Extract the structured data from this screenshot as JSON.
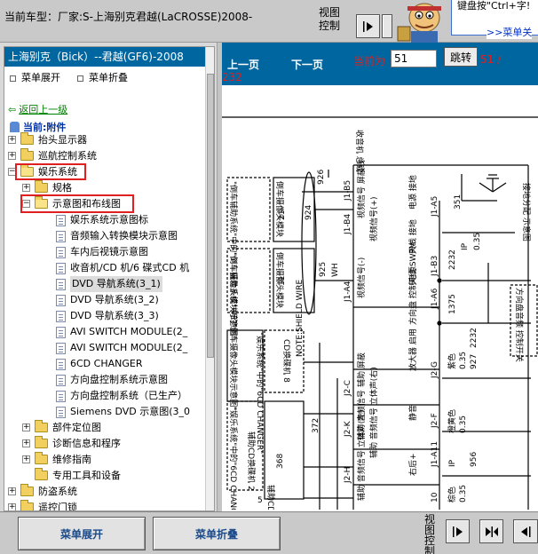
{
  "top": {
    "car_label": "当前车型：厂家:S-上海别克君越(LaCROSSE)2008-",
    "view_control": "视图控制",
    "tip_text": "键盘按\"Ctrl+字!",
    "tip_link": ">>菜单关"
  },
  "left": {
    "model_header": "上海别克（Bick）--君越(GF6)-2008",
    "menu_expand": "菜单展开",
    "menu_collapse": "菜单折叠",
    "back_link": "返回上一级",
    "current": "当前:附件",
    "tree": [
      {
        "label": "抬头显示器"
      },
      {
        "label": "巡航控制系统"
      },
      {
        "label": "娱乐系统"
      },
      {
        "label": "规格"
      },
      {
        "label": "示意图和布线图"
      },
      {
        "label": "娱乐系统示意图标"
      },
      {
        "label": "音频输入转换模块示意图"
      },
      {
        "label": "车内后视镜示意图"
      },
      {
        "label": "收音机/CD 机/6 碟式CD 机"
      },
      {
        "label": "DVD 导航系统(3_1)"
      },
      {
        "label": "DVD 导航系统(3_2)"
      },
      {
        "label": "DVD 导航系统(3_3)"
      },
      {
        "label": "AVI SWITCH MODULE(2_"
      },
      {
        "label": "AVI SWITCH MODULE(2_"
      },
      {
        "label": "6CD CHANGER"
      },
      {
        "label": "方向盘控制系统示意图"
      },
      {
        "label": "方向盘控制系统（已生产）"
      },
      {
        "label": "Siemens DVD 示意图(3_0"
      },
      {
        "label": "部件定位图"
      },
      {
        "label": "诊断信息和程序"
      },
      {
        "label": "维修指南"
      },
      {
        "label": "专用工具和设备"
      },
      {
        "label": "防盗系统"
      },
      {
        "label": "遥控门锁"
      }
    ]
  },
  "nav": {
    "prev": "上一页",
    "next": "下一页",
    "current_label": "当前为",
    "page_value": "51",
    "jump": "跳转",
    "page_of": "51 /",
    "page_total": "232"
  },
  "diagram": {
    "labels": {
      "l1": "收音机 总成",
      "l2": "\"倒车辅助系统\"中的\"倒车摄像头模块示意图\"",
      "l3": "倒车摄像头模块",
      "l4": "\"倒车辅助系统\"中的\"倒车摄像头模块示意图\"",
      "l5": "倒车摄像头模块",
      "l6": "926",
      "l7": "924",
      "l8": "21",
      "l9": "925",
      "l10": "WH",
      "l11": "11",
      "l12": "J1-B5",
      "l13": "J1-B4",
      "l14": "J1-A4",
      "l15": "视频信号 屏蔽线",
      "l16": "视频信号(+)",
      "l17": "视频信号(-)",
      "l18": "电源 接地",
      "l19": "天线 接地",
      "l20": "天线 SWPM",
      "l21": "J1-A5",
      "l22": "351",
      "l23": "J1-B3",
      "l24": "2232",
      "l25": "IP",
      "l26": "0.35",
      "l27": "J1-A6",
      "l28": "1375",
      "l29": "方向盘 控制电源",
      "l30": "方向盘音频 控制开关",
      "l31": "接地分配 示意图",
      "l32": "\"娱乐系统\"中的\"6CD CHANGER\"",
      "l33": "CD换碟机 8",
      "l34": "NOTE:SHIELD WIRE",
      "l35": "372",
      "l36": "368",
      "l37": "J2-C",
      "l38": "J2-K",
      "l39": "J2-H",
      "l40": "J2-G",
      "l41": "J2-F",
      "l42": "J1-A11",
      "l43": "辅助 屏蔽",
      "l44": "辅助 音频信号",
      "l45": "辅助 音频信号 立体声(右)",
      "l46": "辅助 音频信号 立体声(左)",
      "l47": "放大器 启用",
      "l48": "静音",
      "l49": "右后+",
      "l50": "紫色",
      "l51": "0.35",
      "l52": "927",
      "l53": "2232",
      "l54": "橙黄色",
      "l55": "0.35",
      "l56": "IP",
      "l57": "956",
      "l58": "棕色",
      "l59": "0.35",
      "l60": "10",
      "l61": "\"娱乐系统\"中的\"6CD CHANGER\"",
      "l62": "辅助CD换碟机 2",
      "l63": "辅助CD换碟机",
      "l64": "5"
    }
  },
  "bottom": {
    "menu_expand": "菜单展开",
    "menu_collapse": "菜单折叠",
    "view_control": "视图控制"
  },
  "colors": {
    "nav_blue": "#0066a0",
    "highlight_red": "#e02020",
    "folder_yellow": "#f2d060"
  }
}
